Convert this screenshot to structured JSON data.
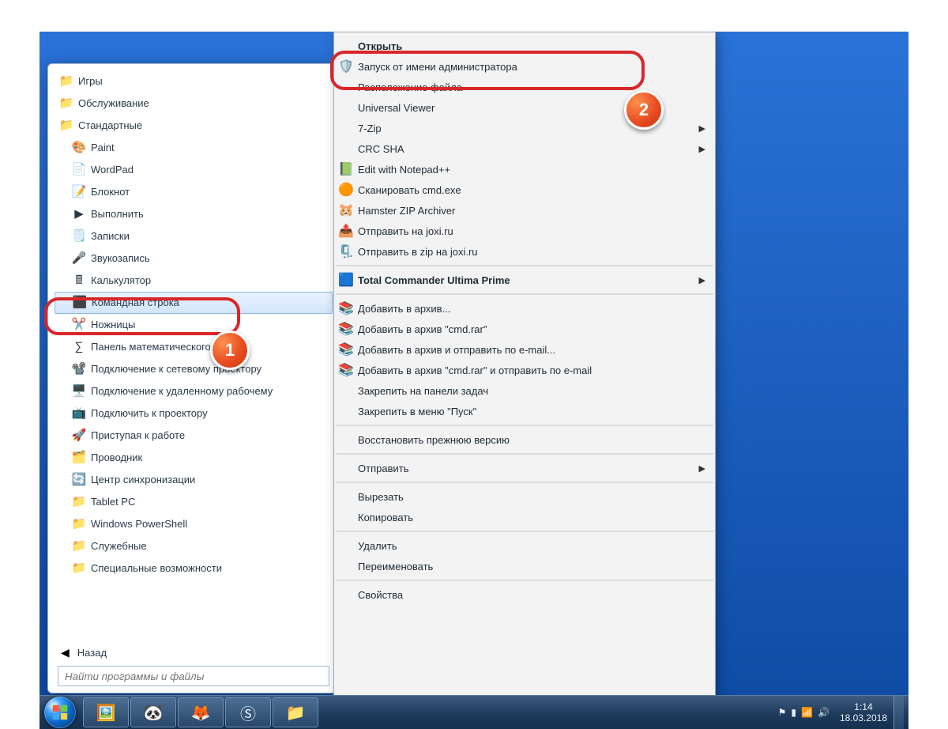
{
  "start_menu": {
    "items": [
      {
        "label": "Игры",
        "icon": "folder-icon",
        "indent": 0
      },
      {
        "label": "Обслуживание",
        "icon": "folder-icon",
        "indent": 0
      },
      {
        "label": "Стандартные",
        "icon": "folder-icon",
        "indent": 0
      },
      {
        "label": "Paint",
        "icon": "paint-icon",
        "indent": 1
      },
      {
        "label": "WordPad",
        "icon": "wordpad-icon",
        "indent": 1
      },
      {
        "label": "Блокнот",
        "icon": "notepad-icon",
        "indent": 1
      },
      {
        "label": "Выполнить",
        "icon": "run-icon",
        "indent": 1
      },
      {
        "label": "Записки",
        "icon": "sticky-notes-icon",
        "indent": 1
      },
      {
        "label": "Звукозапись",
        "icon": "microphone-icon",
        "indent": 1
      },
      {
        "label": "Калькулятор",
        "icon": "calculator-icon",
        "indent": 1
      },
      {
        "label": "Командная строка",
        "icon": "cmd-icon",
        "indent": 1,
        "selected": true
      },
      {
        "label": "Ножницы",
        "icon": "scissors-icon",
        "indent": 1
      },
      {
        "label": "Панель математического ввода",
        "icon": "math-panel-icon",
        "indent": 1
      },
      {
        "label": "Подключение к сетевому проектору",
        "icon": "projector-icon",
        "indent": 1
      },
      {
        "label": "Подключение к удаленному рабочему",
        "icon": "rdp-icon",
        "indent": 1
      },
      {
        "label": "Подключить к проектору",
        "icon": "projector2-icon",
        "indent": 1
      },
      {
        "label": "Приступая к работе",
        "icon": "getting-started-icon",
        "indent": 1
      },
      {
        "label": "Проводник",
        "icon": "explorer-icon",
        "indent": 1
      },
      {
        "label": "Центр синхронизации",
        "icon": "sync-center-icon",
        "indent": 1
      },
      {
        "label": "Tablet PC",
        "icon": "folder-icon",
        "indent": 1
      },
      {
        "label": "Windows PowerShell",
        "icon": "folder-icon",
        "indent": 1
      },
      {
        "label": "Служебные",
        "icon": "folder-icon",
        "indent": 1
      },
      {
        "label": "Специальные возможности",
        "icon": "folder-icon",
        "indent": 1
      }
    ],
    "back_label": "Назад",
    "search_placeholder": "Найти программы и файлы"
  },
  "callouts": {
    "1": "1",
    "2": "2"
  },
  "context_menu": {
    "items": [
      {
        "label": "Открыть",
        "bold": true
      },
      {
        "label": "Запуск от имени администратора",
        "icon": "shield-icon",
        "highlighted": true
      },
      {
        "label": "Расположение файла"
      },
      {
        "label": "Universal Viewer"
      },
      {
        "label": "7-Zip",
        "submenu": true
      },
      {
        "label": "CRC SHA",
        "submenu": true
      },
      {
        "label": "Edit with Notepad++",
        "icon": "notepadpp-icon"
      },
      {
        "label": "Сканировать cmd.exe",
        "icon": "avast-icon"
      },
      {
        "label": "Hamster ZIP Archiver",
        "icon": "hamster-icon"
      },
      {
        "label": "Отправить на joxi.ru",
        "icon": "joxi-icon"
      },
      {
        "label": "Отправить в zip на joxi.ru",
        "icon": "joxi-zip-icon"
      },
      {
        "sep": true
      },
      {
        "label": "Total Commander Ultima Prime",
        "bold": true,
        "icon": "totalcmd-icon",
        "submenu": true
      },
      {
        "sep": true
      },
      {
        "label": "Добавить в архив...",
        "icon": "winrar-icon"
      },
      {
        "label": "Добавить в архив \"cmd.rar\"",
        "icon": "winrar-icon"
      },
      {
        "label": "Добавить в архив и отправить по e-mail...",
        "icon": "winrar-icon"
      },
      {
        "label": "Добавить в архив \"cmd.rar\" и отправить по e-mail",
        "icon": "winrar-icon"
      },
      {
        "label": "Закрепить на панели задач"
      },
      {
        "label": "Закрепить в меню \"Пуск\""
      },
      {
        "sep": true
      },
      {
        "label": "Восстановить прежнюю версию"
      },
      {
        "sep": true
      },
      {
        "label": "Отправить",
        "submenu": true
      },
      {
        "sep": true
      },
      {
        "label": "Вырезать"
      },
      {
        "label": "Копировать"
      },
      {
        "sep": true
      },
      {
        "label": "Удалить"
      },
      {
        "label": "Переименовать"
      },
      {
        "sep": true
      },
      {
        "label": "Свойства"
      }
    ]
  },
  "taskbar": {
    "buttons": [
      {
        "name": "app-unknown",
        "glyph": "🖼️"
      },
      {
        "name": "app-panda",
        "glyph": "🐼"
      },
      {
        "name": "app-firefox",
        "glyph": "🦊"
      },
      {
        "name": "app-skype",
        "glyph": "Ⓢ"
      },
      {
        "name": "app-explorer",
        "glyph": "📁"
      }
    ],
    "tray": {
      "icons": [
        "⚑",
        "▮",
        "📶",
        "🔊"
      ],
      "time": "1:14",
      "date": "18.03.2018"
    }
  },
  "icon_glyphs": {
    "folder-icon": "📁",
    "paint-icon": "🎨",
    "wordpad-icon": "📄",
    "notepad-icon": "📝",
    "run-icon": "▶",
    "sticky-notes-icon": "🗒️",
    "microphone-icon": "🎤",
    "calculator-icon": "🖩",
    "cmd-icon": "⬛",
    "scissors-icon": "✂️",
    "math-panel-icon": "∑",
    "projector-icon": "📽️",
    "rdp-icon": "🖥️",
    "projector2-icon": "📺",
    "getting-started-icon": "🚀",
    "explorer-icon": "🗂️",
    "sync-center-icon": "🔄",
    "shield-icon": "🛡️",
    "notepadpp-icon": "📗",
    "avast-icon": "🟠",
    "hamster-icon": "🐹",
    "joxi-icon": "📤",
    "joxi-zip-icon": "🗜️",
    "totalcmd-icon": "🟦",
    "winrar-icon": "📚"
  }
}
